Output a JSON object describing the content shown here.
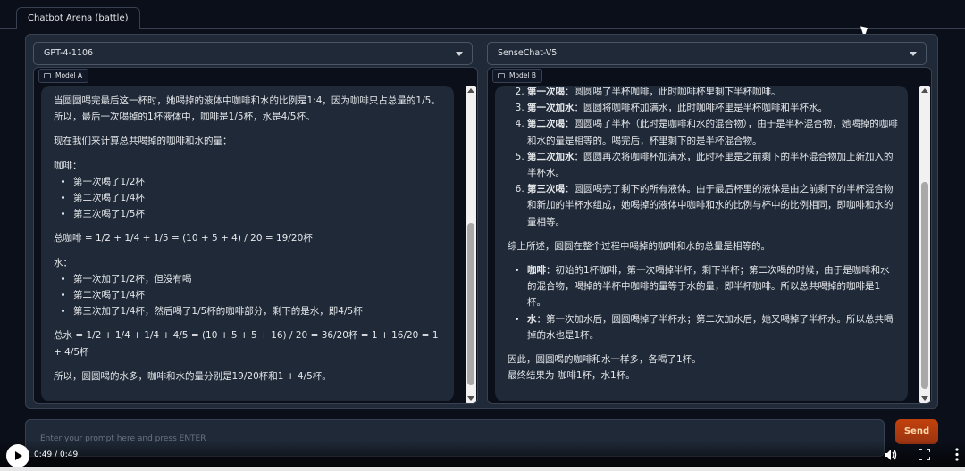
{
  "tab": {
    "label": "Chatbot Arena (battle)"
  },
  "left": {
    "model": "GPT-4-1106",
    "label": "Model A",
    "blocks": [
      {
        "type": "p",
        "text": "当圆圆喝完最后这一杯时，她喝掉的液体中咖啡和水的比例是1:4，因为咖啡只占总量的1/5。所以，最后一次喝掉的1杯液体中，咖啡是1/5杯，水是4/5杯。"
      },
      {
        "type": "p",
        "text": "现在我们来计算总共喝掉的咖啡和水的量："
      },
      {
        "type": "p",
        "text": "咖啡："
      },
      {
        "type": "ul",
        "items": [
          "第一次喝了1/2杯",
          "第二次喝了1/4杯",
          "第三次喝了1/5杯"
        ]
      },
      {
        "type": "p",
        "text": "总咖啡 = 1/2 + 1/4 + 1/5 = (10 + 5 + 4) / 20 = 19/20杯"
      },
      {
        "type": "p",
        "text": "水："
      },
      {
        "type": "ul",
        "items": [
          "第一次加了1/2杯，但没有喝",
          "第二次喝了1/4杯",
          "第三次加了1/4杯，然后喝了1/5杯的咖啡部分，剩下的是水，即4/5杯"
        ]
      },
      {
        "type": "p",
        "text": "总水 = 1/2 + 1/4 + 1/4 + 4/5 = (10 + 5 + 5 + 16) / 20 = 36/20杯 = 1 + 16/20 = 1 + 4/5杯"
      },
      {
        "type": "p",
        "text": "所以，圆圆喝的水多，咖啡和水的量分别是19/20杯和1 + 4/5杯。"
      }
    ]
  },
  "right": {
    "model": "SenseChat-V5",
    "label": "Model B",
    "blocks": [
      {
        "type": "ol",
        "start": 2,
        "items": [
          {
            "b": "第一次喝",
            "t": "：圆圆喝了半杯咖啡，此时咖啡杯里剩下半杯咖啡。"
          },
          {
            "b": "第一次加水",
            "t": "：圆圆将咖啡杯加满水，此时咖啡杯里是半杯咖啡和半杯水。"
          },
          {
            "b": "第二次喝",
            "t": "：圆圆喝了半杯（此时是咖啡和水的混合物），由于是半杯混合物，她喝掉的咖啡和水的量是相等的。喝完后，杯里剩下的是半杯混合物。"
          },
          {
            "b": "第二次加水",
            "t": "：圆圆再次将咖啡杯加满水，此时杯里是之前剩下的半杯混合物加上新加入的半杯水。"
          },
          {
            "b": "第三次喝",
            "t": "：圆圆喝完了剩下的所有液体。由于最后杯里的液体是由之前剩下的半杯混合物和新加的半杯水组成，她喝掉的液体中咖啡和水的比例与杯中的比例相同，即咖啡和水的量相等。"
          }
        ]
      },
      {
        "type": "p",
        "text": "综上所述，圆圆在整个过程中喝掉的咖啡和水的总量是相等的。"
      },
      {
        "type": "ulb",
        "items": [
          {
            "b": "咖啡",
            "t": "：初始的1杯咖啡，第一次喝掉半杯，剩下半杯；第二次喝的时候，由于是咖啡和水的混合物，喝掉的半杯中咖啡的量等于水的量，即半杯咖啡。所以总共喝掉的咖啡是1杯。"
          },
          {
            "b": "水",
            "t": "：第一次加水后，圆圆喝掉了半杯水；第二次加水后，她又喝掉了半杯水。所以总共喝掉的水也是1杯。"
          }
        ]
      },
      {
        "type": "p",
        "text": "因此，圆圆喝的咖啡和水一样多，各喝了1杯。"
      },
      {
        "type": "pt",
        "text": "最终结果为 咖啡1杯，水1杯。"
      }
    ]
  },
  "prompt": {
    "placeholder": "Enter your prompt here and press ENTER"
  },
  "send": {
    "label": "Send"
  },
  "video": {
    "time": "0:49 / 0:49"
  },
  "colors": {
    "accent": "#c2410c",
    "panel": "#1f2937",
    "background": "#0b0f19"
  },
  "icons": [
    "play-icon",
    "volume-icon",
    "fullscreen-icon",
    "more-icon",
    "chat-bubble-icon",
    "chevron-down-icon"
  ]
}
